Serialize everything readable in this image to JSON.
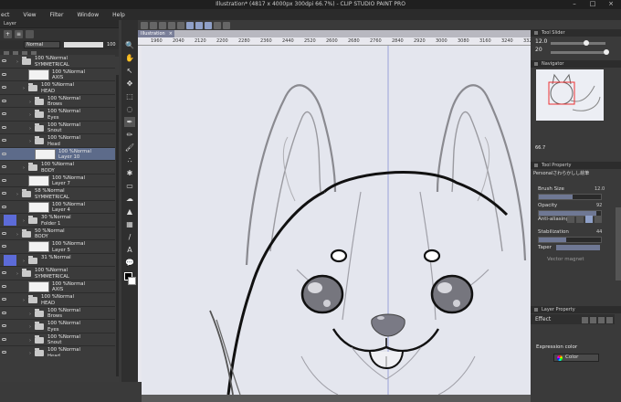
{
  "app": {
    "title": "Illustration* (4817 x 4000px 300dpi 66.7%)  - CLIP STUDIO PAINT PRO"
  },
  "menu": [
    "ect",
    "View",
    "Filter",
    "Window",
    "Help"
  ],
  "layer_panel": {
    "title": "Layer",
    "blend_mode": "Normal",
    "opacity": "100"
  },
  "layers": [
    {
      "line1": "100 %Normal",
      "line2": "SYMMETRICAL",
      "kind": "folder",
      "indent": 0
    },
    {
      "line1": "100 %Normal",
      "line2": "AXIS",
      "kind": "layer",
      "indent": 1
    },
    {
      "line1": "100 %Normal",
      "line2": "HEAD",
      "kind": "folder",
      "indent": 1
    },
    {
      "line1": "100 %Normal",
      "line2": "Brows",
      "kind": "folder",
      "indent": 2
    },
    {
      "line1": "100 %Normal",
      "line2": "Eyes",
      "kind": "folder",
      "indent": 2
    },
    {
      "line1": "100 %Normal",
      "line2": "Snout",
      "kind": "folder",
      "indent": 2
    },
    {
      "line1": "100 %Normal",
      "line2": "Head",
      "kind": "folder",
      "indent": 2
    },
    {
      "line1": "100 %Normal",
      "line2": "Layer 10",
      "kind": "layer",
      "indent": 2,
      "selected": true
    },
    {
      "line1": "100 %Normal",
      "line2": "BODY",
      "kind": "folder",
      "indent": 1
    },
    {
      "line1": "100 %Normal",
      "line2": "Layer 7",
      "kind": "layer",
      "indent": 1
    },
    {
      "line1": "58 %Normal",
      "line2": "SYMMETRICAL",
      "kind": "folder",
      "indent": 0
    },
    {
      "line1": "100 %Normal",
      "line2": "Layer 4",
      "kind": "layer",
      "indent": 1
    },
    {
      "line1": "30 %Normal",
      "line2": "Folder 1",
      "kind": "folder",
      "indent": 1,
      "swatch": true
    },
    {
      "line1": "50 %Normal",
      "line2": "BODY",
      "kind": "folder",
      "indent": 0
    },
    {
      "line1": "100 %Normal",
      "line2": "Layer 5",
      "kind": "layer",
      "indent": 1
    },
    {
      "line1": "31 %Normal",
      "line2": "",
      "kind": "folder",
      "indent": 1,
      "swatch": true
    },
    {
      "line1": "100 %Normal",
      "line2": "SYMMETRICAL",
      "kind": "folder",
      "indent": 0
    },
    {
      "line1": "100 %Normal",
      "line2": "AXIS",
      "kind": "layer",
      "indent": 1
    },
    {
      "line1": "100 %Normal",
      "line2": "HEAD",
      "kind": "folder",
      "indent": 1
    },
    {
      "line1": "100 %Normal",
      "line2": "Brows",
      "kind": "folder",
      "indent": 2
    },
    {
      "line1": "100 %Normal",
      "line2": "Eyes",
      "kind": "folder",
      "indent": 2
    },
    {
      "line1": "100 %Normal",
      "line2": "Snout",
      "kind": "folder",
      "indent": 2
    },
    {
      "line1": "100 %Normal",
      "line2": "Head",
      "kind": "folder",
      "indent": 2
    }
  ],
  "canvas": {
    "tab": "Illustration",
    "ruler_marks": [
      "1960",
      "2040",
      "2120",
      "2200",
      "2280",
      "2360",
      "2440",
      "2520",
      "2600",
      "2680",
      "2760",
      "2840",
      "2920",
      "3000",
      "3080",
      "3160",
      "3240",
      "3320"
    ]
  },
  "tool_slider": {
    "title": "Tool Slider",
    "size": "12.0",
    "label": "20"
  },
  "navigator": {
    "title": "Navigator",
    "zoom": "66.7"
  },
  "tool_property": {
    "title": "Tool Property",
    "tool_name": "Personalさわらかしし絵筆",
    "brush_size": {
      "label": "Brush Size",
      "value": "12.0",
      "level": 0.55
    },
    "opacity": {
      "label": "Opacity",
      "value": "92",
      "level": 0.92
    },
    "antialiasing": {
      "label": "Anti-aliasing"
    },
    "stabilization": {
      "label": "Stabilization",
      "value": "44",
      "level": 0.44
    },
    "taper": {
      "label": "Taper"
    },
    "vector": {
      "label": "Vector magnet"
    }
  },
  "layer_property": {
    "title": "Layer Property",
    "effect": "Effect",
    "expression_color": "Expression color",
    "color": "Color"
  }
}
